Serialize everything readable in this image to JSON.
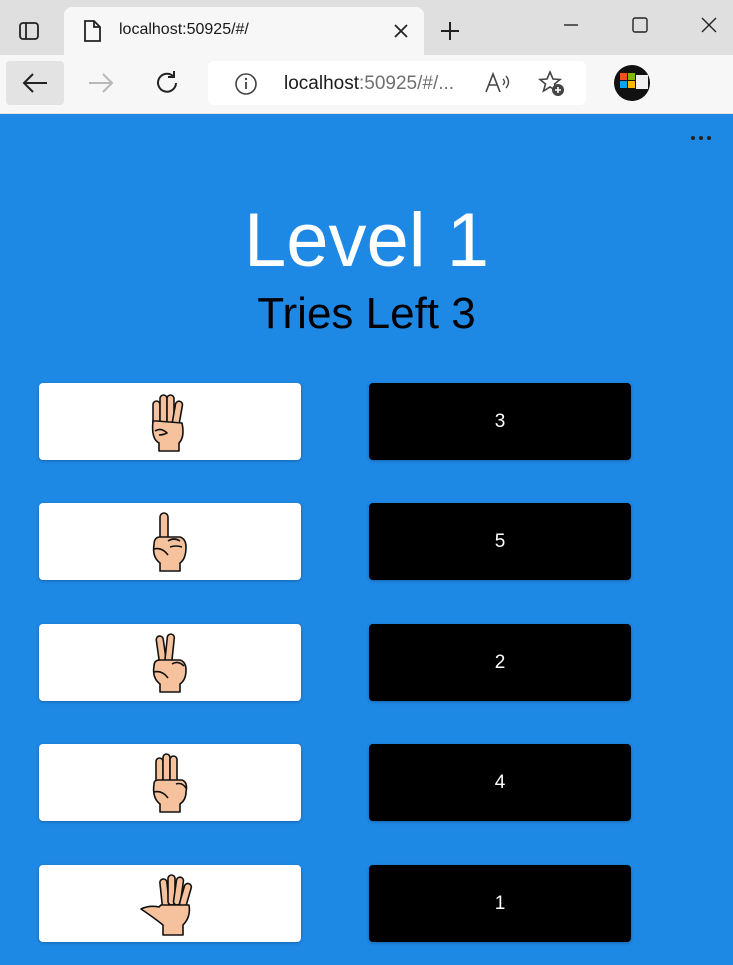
{
  "browser": {
    "tab_title": "localhost:50925/#/",
    "url_host": "localhost",
    "url_rest": ":50925/#/...",
    "icons": [
      "tab-actions-icon",
      "page-icon",
      "close-icon",
      "plus-icon",
      "minimize-icon",
      "maximize-icon",
      "window-close-icon",
      "back-arrow-icon",
      "forward-arrow-icon",
      "reload-icon",
      "info-icon",
      "read-aloud-icon",
      "add-favorite-icon",
      "profile-avatar",
      "more-icon"
    ]
  },
  "game": {
    "title": "Level 1",
    "tries": "Tries Left 3",
    "left_cards": [
      {
        "icon": "hand-four-fingers-icon"
      },
      {
        "icon": "hand-one-finger-icon"
      },
      {
        "icon": "hand-two-fingers-icon"
      },
      {
        "icon": "hand-three-fingers-icon"
      },
      {
        "icon": "hand-five-fingers-icon"
      }
    ],
    "right_cards": [
      "3",
      "5",
      "2",
      "4",
      "1"
    ]
  },
  "colors": {
    "background": "#1e88e5",
    "left_card": "#ffffff",
    "right_card": "#000000",
    "skin": "#f6c29e"
  }
}
